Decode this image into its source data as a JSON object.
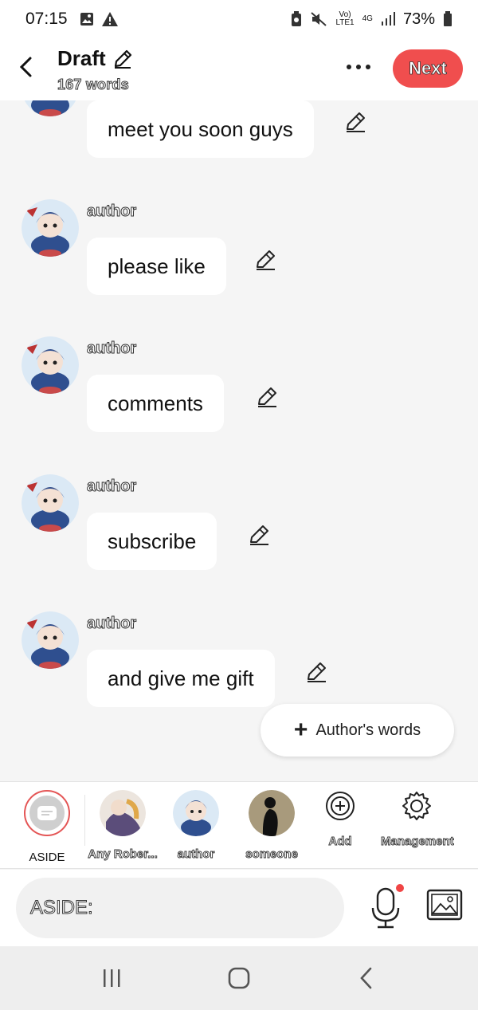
{
  "status_bar": {
    "time": "07:15",
    "network_top": "Vo)",
    "network_bottom": "LTE1",
    "network_gen": "4G",
    "battery": "73%"
  },
  "header": {
    "title": "Draft",
    "word_count": "167 words",
    "next_label": "Next"
  },
  "messages": [
    {
      "author": "",
      "text": "meet you soon guys"
    },
    {
      "author": "author",
      "text": "please like"
    },
    {
      "author": "author",
      "text": "comments"
    },
    {
      "author": "author",
      "text": "subscribe"
    },
    {
      "author": "author",
      "text": "and give me gift"
    }
  ],
  "add_author_words": "Author's words",
  "characters": [
    {
      "label": "ASIDE"
    },
    {
      "label": "Any Rober..."
    },
    {
      "label": "author"
    },
    {
      "label": "someone"
    },
    {
      "label": "Add"
    },
    {
      "label": "Management"
    }
  ],
  "input": {
    "placeholder": "ASIDE:"
  },
  "colors": {
    "accent": "#f04e4e",
    "background": "#f5f5f5",
    "bubble": "#ffffff"
  },
  "icons": [
    "back-icon",
    "pencil-icon",
    "more-icon",
    "edit-icon",
    "plus-icon",
    "add-circle-icon",
    "gear-icon",
    "microphone-icon",
    "image-icon",
    "recents-icon",
    "home-icon",
    "nav-back-icon"
  ]
}
